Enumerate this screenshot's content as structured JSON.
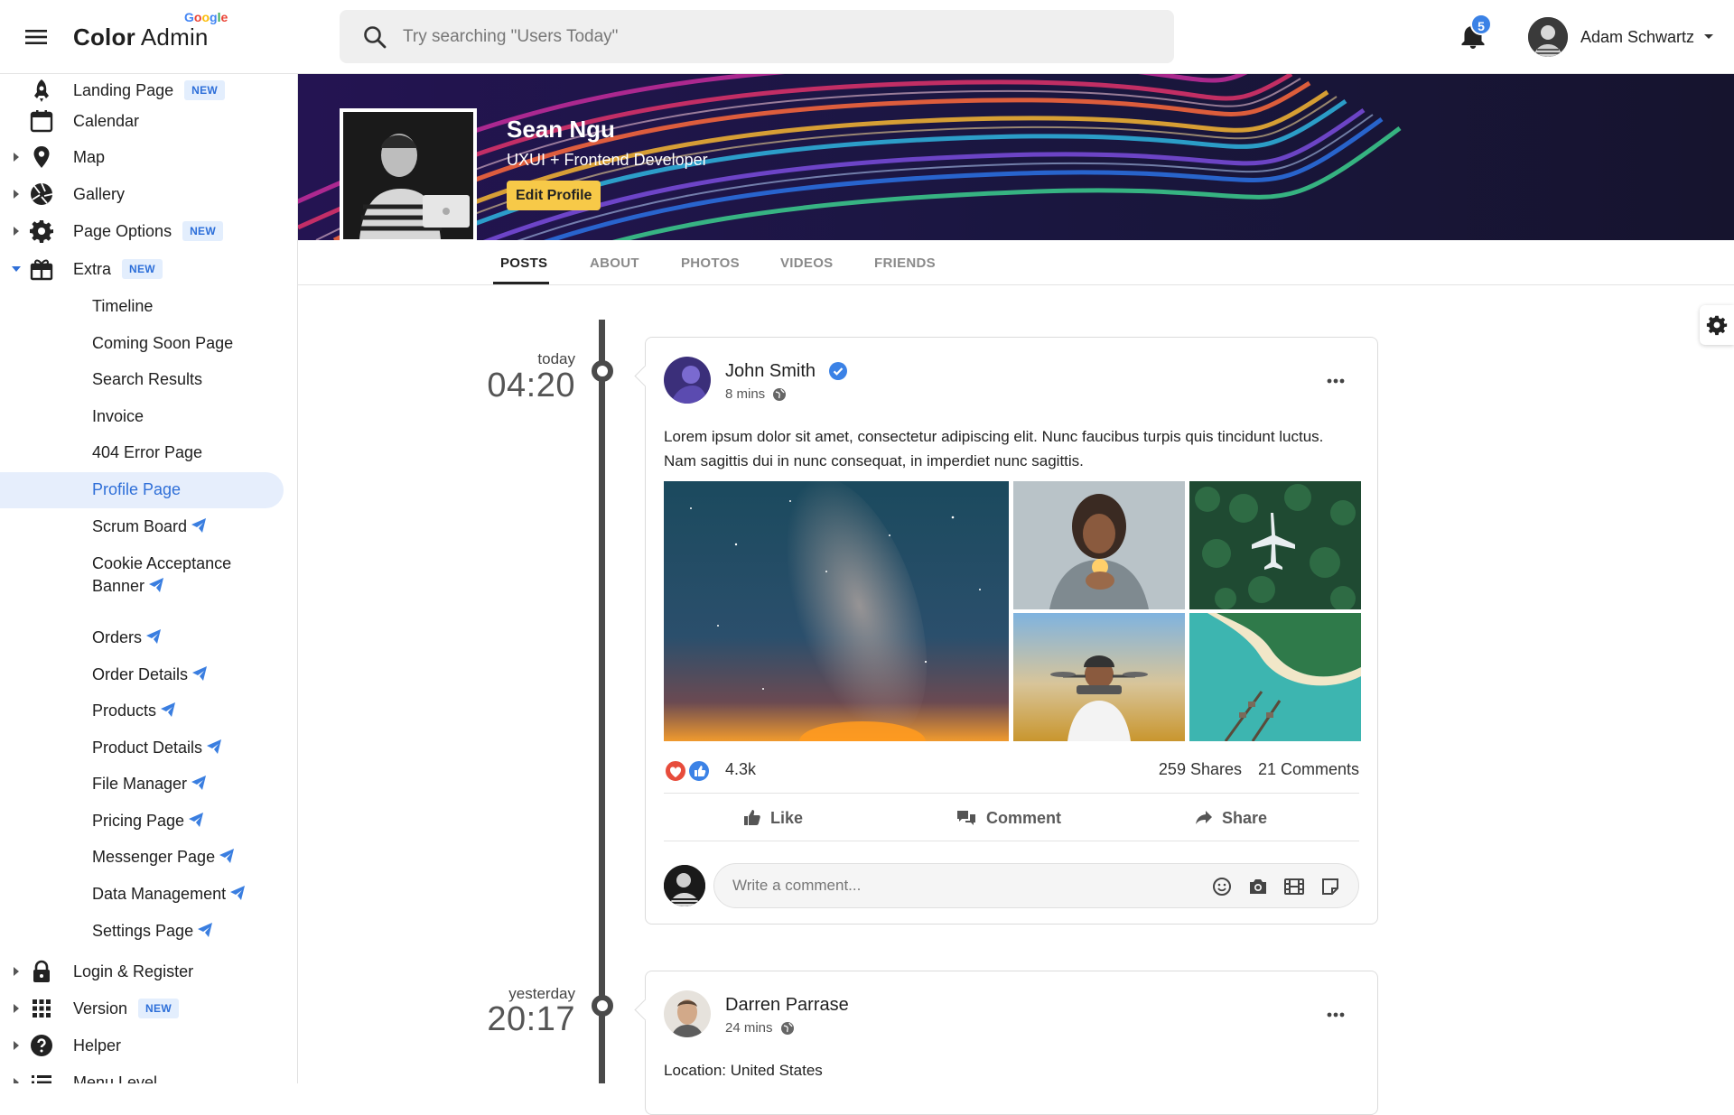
{
  "header": {
    "brand_bold": "Color",
    "brand_light": " Admin",
    "brand_google": "Google",
    "search_placeholder": "Try searching \"Users Today\"",
    "notification_count": "5",
    "user_name": "Adam Schwartz"
  },
  "sidebar": {
    "items": [
      {
        "label": "Landing Page",
        "badge": "NEW",
        "icon": "rocket-icon"
      },
      {
        "label": "Calendar",
        "icon": "calendar-icon"
      },
      {
        "label": "Map",
        "icon": "map-pin-icon"
      },
      {
        "label": "Gallery",
        "icon": "aperture-icon"
      },
      {
        "label": "Page Options",
        "badge": "NEW",
        "icon": "gear-icon"
      },
      {
        "label": "Extra",
        "badge": "NEW",
        "icon": "gift-icon"
      },
      {
        "label": "Login & Register",
        "icon": "lock-icon"
      },
      {
        "label": "Version",
        "badge": "NEW",
        "icon": "grid-icon"
      },
      {
        "label": "Helper",
        "icon": "help-icon"
      },
      {
        "label": "Menu Level",
        "icon": "list-icon"
      }
    ],
    "extra_sub": [
      {
        "label": "Timeline"
      },
      {
        "label": "Coming Soon Page"
      },
      {
        "label": "Search Results"
      },
      {
        "label": "Invoice"
      },
      {
        "label": "404 Error Page"
      },
      {
        "label": "Profile Page",
        "active": true
      },
      {
        "label": "Scrum Board"
      },
      {
        "label": "Cookie Acceptance"
      },
      {
        "label": "Banner"
      },
      {
        "label": "Orders"
      },
      {
        "label": "Order Details"
      },
      {
        "label": "Products"
      },
      {
        "label": "Product Details"
      },
      {
        "label": "File Manager"
      },
      {
        "label": "Pricing Page"
      },
      {
        "label": "Messenger Page"
      },
      {
        "label": "Data Management"
      },
      {
        "label": "Settings Page"
      }
    ]
  },
  "profile": {
    "name": "Sean Ngu",
    "title": "UXUI + Frontend Developer",
    "edit_label": "Edit Profile"
  },
  "tabs": [
    "POSTS",
    "ABOUT",
    "PHOTOS",
    "VIDEOS",
    "FRIENDS"
  ],
  "timeline": [
    {
      "day": "today",
      "time": "04:20",
      "author": "John Smith",
      "ago": "8 mins",
      "text": "Lorem ipsum dolor sit amet, consectetur adipiscing elit. Nunc faucibus turpis quis tincidunt luctus. Nam sagittis dui in nunc consequat, in imperdiet nunc sagittis.",
      "reactions": "4.3k",
      "shares": "259 Shares",
      "comments": "21 Comments",
      "like_label": "Like",
      "comment_label": "Comment",
      "share_label": "Share",
      "comment_placeholder": "Write a comment..."
    },
    {
      "day": "yesterday",
      "time": "20:17",
      "author": "Darren Parrase",
      "ago": "24 mins",
      "text": "Location: United States"
    }
  ],
  "colors": {
    "accent": "#3b82e6",
    "edit_button": "#f7c948",
    "active_nav_bg": "#e6eefc"
  }
}
